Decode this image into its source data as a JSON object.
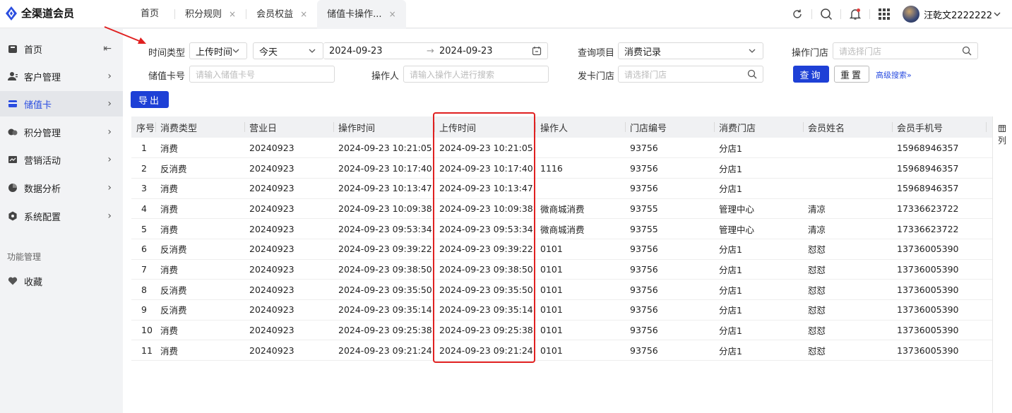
{
  "brand": {
    "name": "全渠道会员"
  },
  "tabs": [
    {
      "label": "首页"
    },
    {
      "label": "积分规则",
      "close": "×"
    },
    {
      "label": "会员权益",
      "close": "×"
    },
    {
      "label": "储值卡操作...",
      "close": "×"
    }
  ],
  "user": {
    "name": "汪乾文2222222"
  },
  "sidebar": {
    "items": [
      {
        "label": "首页",
        "icon": "home-icon"
      },
      {
        "label": "客户管理",
        "icon": "user-icon"
      },
      {
        "label": "储值卡",
        "icon": "card-icon"
      },
      {
        "label": "积分管理",
        "icon": "coins-icon"
      },
      {
        "label": "营销活动",
        "icon": "chart-icon"
      },
      {
        "label": "数据分析",
        "icon": "pie-icon"
      },
      {
        "label": "系统配置",
        "icon": "hexagon-icon"
      }
    ],
    "group_label": "功能管理",
    "favorites_label": "收藏"
  },
  "filters": {
    "time_type_label": "时间类型",
    "time_type_value": "上传时间",
    "period_value": "今天",
    "start_date": "2024-09-23",
    "end_date": "2024-09-23",
    "query_item_label": "查询项目",
    "query_item_value": "消费记录",
    "op_store_label": "操作门店",
    "op_store_placeholder": "请选择门店",
    "card_no_label": "储值卡号",
    "card_no_placeholder": "请输入储值卡号",
    "operator_label": "操作人",
    "operator_placeholder": "请输入操作人进行搜索",
    "issue_store_label": "发卡门店",
    "issue_store_placeholder": "请选择门店",
    "search_btn": "查询",
    "reset_btn": "重置",
    "advanced": "高级搜索"
  },
  "export_btn": "导出",
  "columns_btn": "列",
  "table": {
    "headers": [
      "序号",
      "消费类型",
      "营业日",
      "操作时间",
      "上传时间",
      "操作人",
      "门店编号",
      "消费门店",
      "会员姓名",
      "会员手机号"
    ],
    "rows": [
      [
        "1",
        "消费",
        "20240923",
        "2024-09-23 10:21:05",
        "2024-09-23 10:21:05",
        "",
        "93756",
        "分店1",
        "",
        "15968946357"
      ],
      [
        "2",
        "反消费",
        "20240923",
        "2024-09-23 10:17:40",
        "2024-09-23 10:17:40",
        "1116",
        "93756",
        "分店1",
        "",
        "15968946357"
      ],
      [
        "3",
        "消费",
        "20240923",
        "2024-09-23 10:13:47",
        "2024-09-23 10:13:47",
        "",
        "93756",
        "分店1",
        "",
        "15968946357"
      ],
      [
        "4",
        "消费",
        "20240923",
        "2024-09-23 10:09:38",
        "2024-09-23 10:09:38",
        "微商城消费",
        "93755",
        "管理中心",
        "清凉",
        "17336623722"
      ],
      [
        "5",
        "消费",
        "20240923",
        "2024-09-23 09:53:34",
        "2024-09-23 09:53:34",
        "微商城消费",
        "93755",
        "管理中心",
        "清凉",
        "17336623722"
      ],
      [
        "6",
        "反消费",
        "20240923",
        "2024-09-23 09:39:22",
        "2024-09-23 09:39:22",
        "0101",
        "93756",
        "分店1",
        "怼怼",
        "13736005390"
      ],
      [
        "7",
        "消费",
        "20240923",
        "2024-09-23 09:38:50",
        "2024-09-23 09:38:50",
        "0101",
        "93756",
        "分店1",
        "怼怼",
        "13736005390"
      ],
      [
        "8",
        "反消费",
        "20240923",
        "2024-09-23 09:35:50",
        "2024-09-23 09:35:50",
        "0101",
        "93756",
        "分店1",
        "怼怼",
        "13736005390"
      ],
      [
        "9",
        "反消费",
        "20240923",
        "2024-09-23 09:35:14",
        "2024-09-23 09:35:14",
        "0101",
        "93756",
        "分店1",
        "怼怼",
        "13736005390"
      ],
      [
        "10",
        "消费",
        "20240923",
        "2024-09-23 09:25:38",
        "2024-09-23 09:25:38",
        "0101",
        "93756",
        "分店1",
        "怼怼",
        "13736005390"
      ],
      [
        "11",
        "消费",
        "20240923",
        "2024-09-23 09:21:24",
        "2024-09-23 09:21:24",
        "0101",
        "93756",
        "分店1",
        "怼怼",
        "13736005390"
      ]
    ]
  },
  "colors": {
    "accent": "#1e40d6",
    "highlight": "#e02020",
    "notify": "#e23d3d"
  }
}
